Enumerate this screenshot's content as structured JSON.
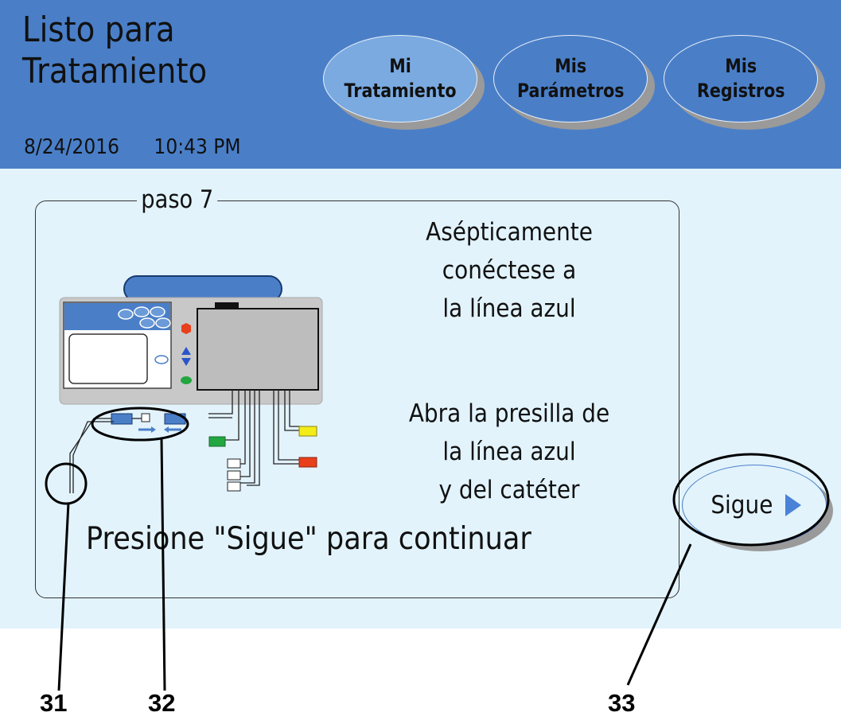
{
  "header": {
    "title_line1": "Listo para",
    "title_line2": "Tratamiento",
    "date": "8/24/2016",
    "time": "10:43 PM"
  },
  "tabs": [
    {
      "line1": "Mi",
      "line2": "Tratamiento",
      "active": true
    },
    {
      "line1": "Mis",
      "line2": "Parámetros",
      "active": false
    },
    {
      "line1": "Mis",
      "line2": "Registros",
      "active": false
    }
  ],
  "step": {
    "label": "paso 7",
    "instruction1": [
      "Asépticamente",
      "conéctese a",
      "la línea azul"
    ],
    "instruction2": [
      "Abra la presilla de",
      "la línea azul",
      "y del catéter"
    ],
    "prompt": "Presione \"Sigue\" para continuar"
  },
  "next_button": {
    "label": "Sigue",
    "icon": "play-arrow-icon"
  },
  "callouts": [
    "31",
    "32",
    "33"
  ],
  "colors": {
    "header_bg": "#4a7fc8",
    "content_bg": "#e2f3fc",
    "active_tab": "#7aaae0",
    "blue_line": "#4a7fc8",
    "red": "#e8401c",
    "yellow": "#f4ec18",
    "green": "#22a640"
  }
}
